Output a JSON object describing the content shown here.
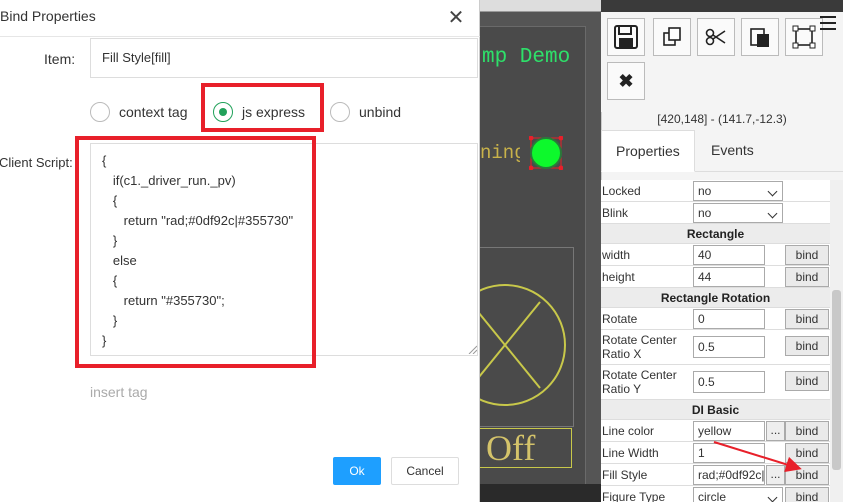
{
  "dialog": {
    "title": "Bind Properties",
    "close_glyph": "✕",
    "item_label": "Item:",
    "item_value": "Fill Style[fill]",
    "modes": [
      {
        "label": "context tag",
        "checked": false
      },
      {
        "label": "js express",
        "checked": true
      },
      {
        "label": "unbind",
        "checked": false
      }
    ],
    "script_label": "Client Script:",
    "script": "{\n   if(c1._driver_run._pv)\n   {\n      return \"rad;#0df92c|#355730\"\n   }\n   else\n   {\n      return \"#355730\";\n   }\n}",
    "insert_tag": "insert tag",
    "ok": "Ok",
    "cancel": "Cancel"
  },
  "canvas": {
    "title_fragment": "mp Demo",
    "running_fragment": "ning",
    "off_text": "Off",
    "lamp_color": "#0df92c"
  },
  "toolbar": {
    "icons": [
      "save-icon",
      "copy-icon",
      "cut-icon",
      "paste-icon",
      "select-bounds-icon",
      "delete-icon",
      "menu-icon"
    ],
    "delete_glyph": "✖"
  },
  "coords": "[420,148] - (141.7,-12.3)",
  "tabs": {
    "properties": "Properties",
    "events": "Events"
  },
  "properties": {
    "locked": {
      "label": "Locked",
      "value": "no"
    },
    "blink": {
      "label": "Blink",
      "value": "no"
    },
    "section_rect": "Rectangle",
    "width": {
      "label": "width",
      "value": "40"
    },
    "height": {
      "label": "height",
      "value": "44"
    },
    "section_rot": "Rectangle Rotation",
    "rotate": {
      "label": "Rotate",
      "value": "0"
    },
    "ratio_x": {
      "label": "Rotate Center Ratio X",
      "value": "0.5"
    },
    "ratio_y": {
      "label": "Rotate Center Ratio Y",
      "value": "0.5"
    },
    "section_di": "DI Basic",
    "line_color": {
      "label": "Line color",
      "value": "yellow"
    },
    "line_width": {
      "label": "Line Width",
      "value": "1"
    },
    "fill_style": {
      "label": "Fill Style",
      "value": "rad;#0df92c|#355730"
    },
    "figure_type": {
      "label": "Figure Type",
      "value": "circle"
    },
    "bind": "bind",
    "dots": "..."
  },
  "colors": {
    "highlight": "#e8202a",
    "accent": "#1e9fff",
    "radio": "#21a15a"
  }
}
